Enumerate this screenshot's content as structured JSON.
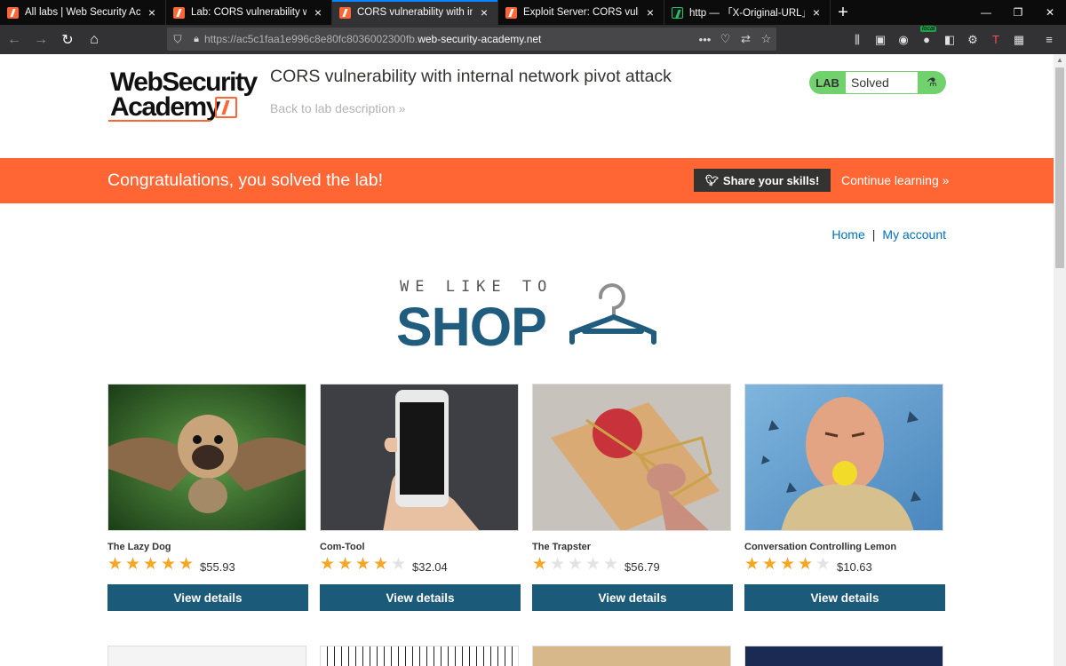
{
  "browser": {
    "tabs": [
      {
        "title": "All labs | Web Security Academy",
        "favicon": "burp-icon",
        "active": false
      },
      {
        "title": "Lab: CORS vulnerability with internal network pivot attack",
        "favicon": "burp-icon",
        "active": false
      },
      {
        "title": "CORS vulnerability with internal network pivot attack",
        "favicon": "burp-icon",
        "active": true
      },
      {
        "title": "Exploit Server: CORS vulnerability with internal network pivot attack",
        "favicon": "burp-icon",
        "active": false
      },
      {
        "title": "http — 「X-Original-URL」および",
        "favicon": "hackerone-icon",
        "active": false
      }
    ],
    "url_prefix": "https://ac5c1faa1e996c8e80fc8036002300fb.",
    "url_domain": "web-security-academy.net",
    "badge_text": "local"
  },
  "header": {
    "logo_line1": "WebSecurity",
    "logo_line2": "Academy",
    "lab_title": "CORS vulnerability with internal network pivot attack",
    "back_link": "Back to lab description",
    "lab_label": "LAB",
    "lab_status": "Solved",
    "status_color": "#70d16d"
  },
  "banner": {
    "message": "Congratulations, you solved the lab!",
    "share_label": "Share your skills!",
    "continue_label": "Continue learning",
    "color": "#ff6633"
  },
  "nav": {
    "home": "Home",
    "separator": "|",
    "account": "My account"
  },
  "hero": {
    "tagline": "WE LIKE TO",
    "word": "SHOP"
  },
  "products": [
    {
      "name": "The Lazy Dog",
      "rating": 5,
      "price": "$55.93",
      "image": "flying-pug-image",
      "button": "View details"
    },
    {
      "name": "Com-Tool",
      "rating": 4,
      "price": "$32.04",
      "image": "smartphone-hand-image",
      "button": "View details"
    },
    {
      "name": "The Trapster",
      "rating": 1,
      "price": "$56.79",
      "image": "mousetrap-image",
      "button": "View details"
    },
    {
      "name": "Conversation Controlling Lemon",
      "rating": 4,
      "price": "$10.63",
      "image": "lemon-mouth-image",
      "button": "View details"
    }
  ]
}
